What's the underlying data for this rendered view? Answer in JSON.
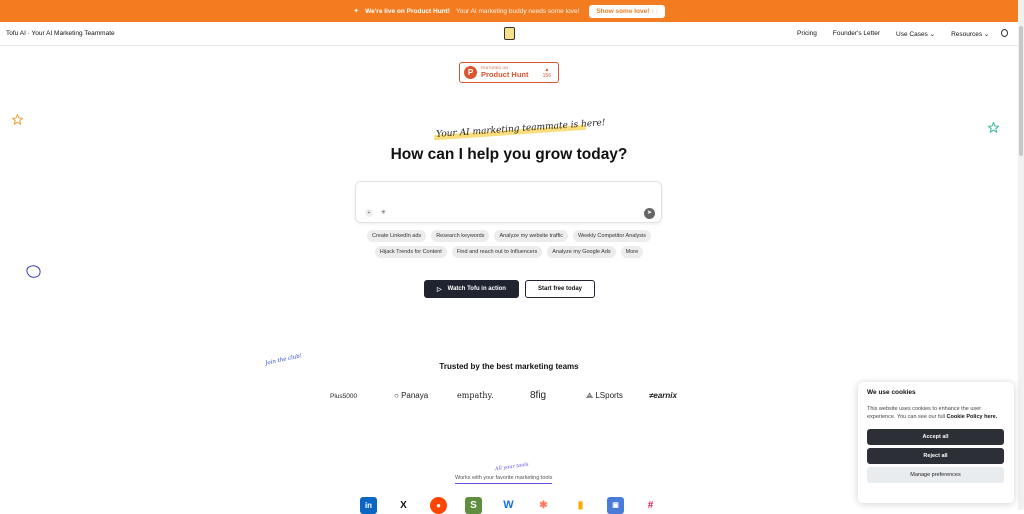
{
  "banner": {
    "icon": "bell-icon",
    "headline": "We're live on Product Hunt!",
    "subtext": "Your AI marketing buddy needs some love!",
    "cta": "Show some love! ↑↑",
    "close": "×",
    "color": "#f47c20"
  },
  "nav": {
    "brand": "Tofu AI · Your AI Marketing Teammate",
    "links": [
      "Pricing",
      "Founder's Letter",
      "Use Cases ⌄",
      "Resources ⌄"
    ]
  },
  "product_hunt": {
    "featured": "FEATURED ON",
    "name": "Product Hunt",
    "votes": "156",
    "arrow": "▲",
    "letter": "P"
  },
  "hero": {
    "tagline": "Your AI marketing teammate is here!",
    "headline": "How can I help you grow today?"
  },
  "chat": {
    "attach_icon": "plus-icon",
    "magic_icon": "sparkle-icon",
    "send_icon": "send-icon"
  },
  "suggestions_row1": [
    "Create LinkedIn ads",
    "Research keywords",
    "Analyze my website traffic",
    "Weekly Competitor Analysis"
  ],
  "suggestions_row2": [
    "Hijack Trends for Content",
    "Find and reach out to Influencers",
    "Analyze my Google Ads",
    "More"
  ],
  "cta": {
    "watch": "Watch Tofu in action",
    "start": "Start free today"
  },
  "trusted": {
    "annotation": "Join the club!",
    "title": "Trusted by the best marketing teams",
    "logos": [
      "Plus5000",
      "Panaya",
      "empathy.",
      "8fig",
      "LSports",
      "earnix"
    ]
  },
  "tools": {
    "annotation": "All your tools",
    "label": "Works with your favorite marketing tools",
    "icons": [
      "linkedin-icon",
      "x-icon",
      "reddit-icon",
      "shopify-icon",
      "webflow-icon",
      "hubspot-icon",
      "google-analytics-icon",
      "notion-icon",
      "slack-icon"
    ]
  },
  "cookie": {
    "title": "We use cookies",
    "body": "This website uses cookies to enhance the user experience. You can see our full",
    "policy": "Cookie Policy",
    "here": "here.",
    "accept": "Accept all",
    "reject": "Reject all",
    "manage": "Manage preferences"
  }
}
